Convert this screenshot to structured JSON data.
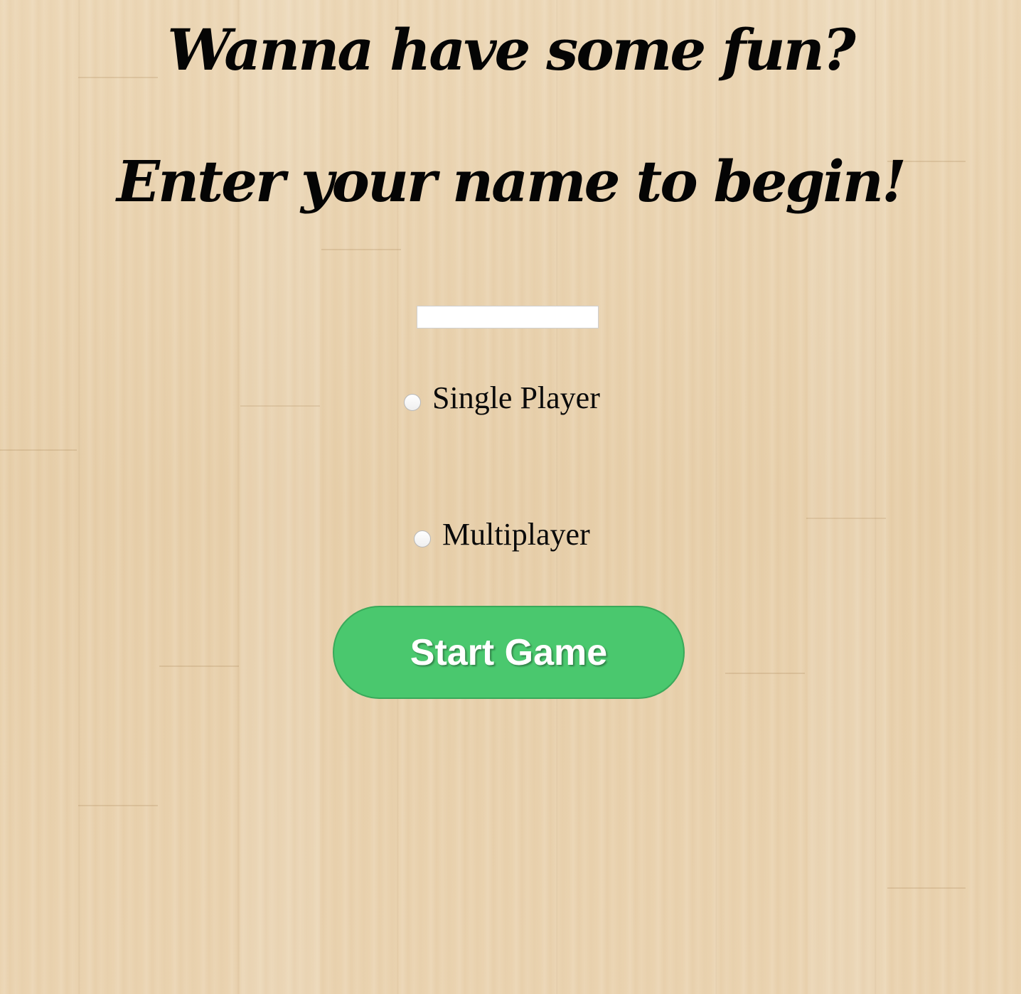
{
  "headings": {
    "title": "Wanna have some fun?",
    "subtitle": "Enter your name to begin!"
  },
  "form": {
    "name_input": {
      "value": "",
      "placeholder": ""
    },
    "modes": [
      {
        "label": "Single Player",
        "selected": false
      },
      {
        "label": "Multiplayer",
        "selected": false
      }
    ],
    "start_button_label": "Start Game"
  },
  "colors": {
    "background": "#ead3b1",
    "button": "#4ac86e",
    "heading": "#050505"
  }
}
